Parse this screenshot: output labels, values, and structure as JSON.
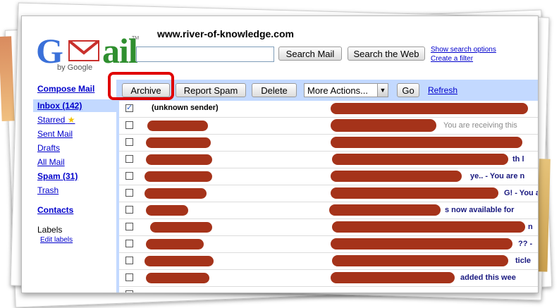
{
  "header": {
    "site": "www.river-of-knowledge.com",
    "logo": {
      "g": "G",
      "ail": "ail",
      "by": "by Google",
      "tm": "TM"
    },
    "search_value": "",
    "search_mail": "Search Mail",
    "search_web": "Search the Web",
    "show_options": "Show search options",
    "create_filter": "Create a filter"
  },
  "toolbar": {
    "archive": "Archive",
    "report_spam": "Report Spam",
    "delete": "Delete",
    "more_actions": "More Actions...",
    "go": "Go",
    "refresh": "Refresh"
  },
  "sidebar": {
    "compose": "Compose Mail",
    "items": [
      {
        "label": "Inbox (142)"
      },
      {
        "label": "Starred"
      },
      {
        "label": "Sent Mail"
      },
      {
        "label": "Drafts"
      },
      {
        "label": "All Mail"
      },
      {
        "label": "Spam (31)"
      },
      {
        "label": "Trash"
      }
    ],
    "contacts": "Contacts",
    "labels": "Labels",
    "edit_labels": "Edit labels"
  },
  "messages": [
    {
      "sender": "(unknown sender)",
      "tail": "",
      "checked": true
    },
    {
      "sender": "",
      "tail": "You are receiving this"
    },
    {
      "sender": "",
      "tail": ""
    },
    {
      "sender": "",
      "tail": "th l"
    },
    {
      "sender": "",
      "tail": "ye.. - You are n"
    },
    {
      "sender": "",
      "tail": "G! - You are r"
    },
    {
      "sender": "",
      "tail": "s now available for"
    },
    {
      "sender": "",
      "tail": "n"
    },
    {
      "sender": "",
      "tail": "?? -"
    },
    {
      "sender": "",
      "tail": "ticle"
    },
    {
      "sender": "",
      "tail": "added this wee"
    }
  ],
  "colors": {
    "toolbar": "#c3d9ff",
    "highlight": "#e00000",
    "link": "#0000cc",
    "redaction": "#a5331a"
  }
}
